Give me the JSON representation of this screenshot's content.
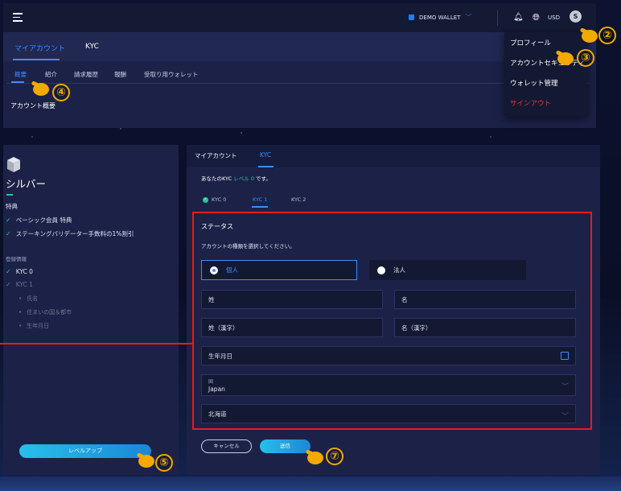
{
  "topbar": {
    "wallet_label": "DEMO  WALLET",
    "currency": "USD",
    "avatar_letter": "S"
  },
  "tabs1": [
    "マイアカウント",
    "KYC"
  ],
  "tabs2": [
    "概要",
    "紹介",
    "請求履歴",
    "報酬",
    "受取り用ウォレット"
  ],
  "overview_title": "アカウント概要",
  "dropdown": {
    "items": [
      "プロフィール",
      "アカウントセキュリティ",
      "ウォレット管理",
      "サインアウト"
    ]
  },
  "sidebar": {
    "level": "シルバー",
    "perks_title": "特典",
    "perks": [
      "ベーシック会員 特典",
      "ステーキングバリデーター手数料の1%割引"
    ],
    "reg_title": "登録情報",
    "kyc0": "KYC 0",
    "kyc1": "KYC 1",
    "kyc1_items": [
      "氏名",
      "住まいの国＆都市",
      "生年月日"
    ],
    "levelup": "レベルアップ"
  },
  "main": {
    "tabs": [
      "マイアカウント",
      "KYC"
    ],
    "kyc_info_pre": "あなたのKYC",
    "kyc_info_level": "レベル 0",
    "kyc_info_post": "です。",
    "kyc_tabs": [
      "KYC 0",
      "KYC 1",
      "KYC 2"
    ],
    "status_title": "ステータス",
    "select_label": "アカウントの種類を選択してください。",
    "radio_individual": "個人",
    "radio_corporate": "法人",
    "last_name": "姓",
    "first_name": "名",
    "last_name_kanji": "姓（漢字）",
    "first_name_kanji": "名（漢字）",
    "birthday": "生年月日",
    "country_label": "国",
    "country_value": "Japan",
    "region_value": "北海道",
    "cancel": "キャンセル",
    "submit": "送信"
  },
  "annotations": {
    "n2": "②",
    "n3": "③",
    "n4": "④",
    "n5": "⑤",
    "n7": "⑦"
  },
  "colors": {
    "accent": "#3d8bff",
    "success": "#20c997",
    "danger": "#e31d1d",
    "marker": "#f2a900"
  }
}
